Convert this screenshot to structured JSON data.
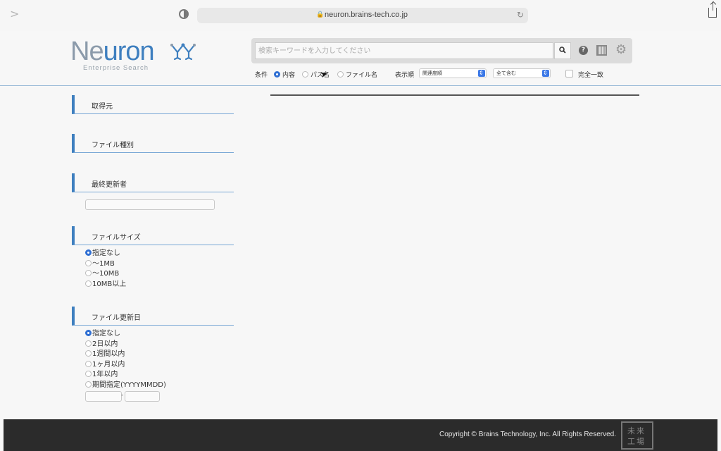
{
  "browser": {
    "url": "neuron.brains-tech.co.jp"
  },
  "logo": {
    "text_part1": "Ne",
    "text_part2": "uron",
    "subtitle": "Enterprise Search"
  },
  "search": {
    "placeholder": "検索キーワードを入力してください",
    "value": ""
  },
  "options": {
    "condition_label": "条件",
    "targets": [
      {
        "label": "内容",
        "selected": true
      },
      {
        "label": "パス名",
        "selected": false
      },
      {
        "label": "ファイル名",
        "selected": false
      }
    ],
    "sort_label": "表示順",
    "sort_value": "関連度順",
    "include_value": "全て含む",
    "exact_match_label": "完全一致",
    "exact_match_checked": false
  },
  "sidebar": {
    "source_title": "取得元",
    "file_type_title": "ファイル種別",
    "last_updater_title": "最終更新者",
    "last_updater_value": "",
    "file_size": {
      "title": "ファイルサイズ",
      "options": [
        "指定なし",
        "〜1MB",
        "〜10MB",
        "10MB以上"
      ],
      "selected": 0
    },
    "file_date": {
      "title": "ファイル更新日",
      "options": [
        "指定なし",
        "2日以内",
        "1週間以内",
        "1ヶ月以内",
        "1年以内",
        "期間指定(YYYYMMDD)"
      ],
      "selected": 0,
      "range_separator": "-",
      "from_value": "",
      "to_value": ""
    }
  },
  "footer": {
    "copyright": "Copyright © Brains Technology, Inc. All Rights Reserved.",
    "partner_logo_line1": "未来",
    "partner_logo_line2": "工場"
  },
  "colors": {
    "brand_blue": "#3e7fbf",
    "radio_selected": "#2f6fd3",
    "footer_bg": "#2b2b2b"
  }
}
